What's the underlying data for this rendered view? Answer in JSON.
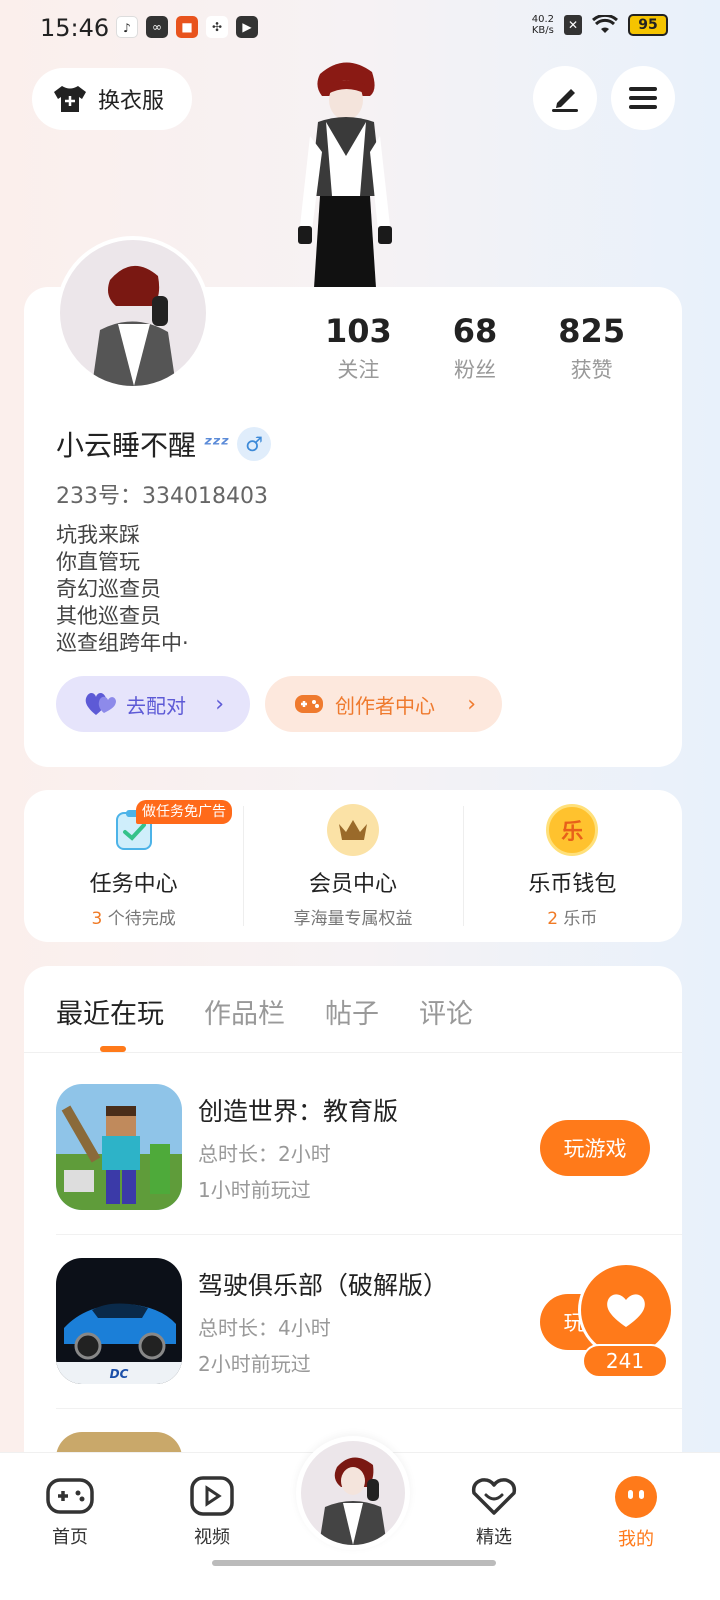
{
  "status_bar": {
    "time": "15:46",
    "speed_value": "40.2",
    "speed_unit": "KB/s",
    "battery": "95",
    "app_icons": [
      "tiktok-icon",
      "link-icon",
      "apps-icon",
      "pinwheel-icon",
      "play-icon"
    ]
  },
  "header": {
    "outfit_label": "换衣服",
    "edit_icon": "pen-icon",
    "menu_icon": "menu-icon"
  },
  "profile": {
    "stats": [
      {
        "value": "103",
        "label": "关注"
      },
      {
        "value": "68",
        "label": "粉丝"
      },
      {
        "value": "825",
        "label": "获赞"
      }
    ],
    "nickname": "小云睡不醒",
    "nickname_emoji": "ᶻᶻᶻ",
    "gender_symbol": "♂",
    "uid": "233号：334018403",
    "bio": [
      "坑我来踩",
      "你直管玩",
      "奇幻巡查员",
      "其他巡查员",
      "巡查组跨年中·"
    ],
    "match_label": "去配对",
    "creator_label": "创作者中心"
  },
  "quick": {
    "task_badge": "做任务免广告",
    "items": [
      {
        "title": "任务中心",
        "count": "3",
        "sub": " 个待完成"
      },
      {
        "title": "会员中心",
        "count": "",
        "sub": "享海量专属权益"
      },
      {
        "title": "乐币钱包",
        "count": "2",
        "sub": " 乐币",
        "coin_glyph": "乐"
      }
    ]
  },
  "recent": {
    "tabs": [
      "最近在玩",
      "作品栏",
      "帖子",
      "评论"
    ],
    "active_tab": 0,
    "play_label": "玩游戏",
    "games": [
      {
        "name": "创造世界：教育版",
        "duration": "总时长：2小时",
        "last": "1小时前玩过"
      },
      {
        "name": "驾驶俱乐部（破解版）",
        "duration": "总时长：4小时",
        "last": "2小时前玩过"
      }
    ]
  },
  "like": {
    "count": "241"
  },
  "nav": {
    "items": [
      {
        "label": "首页"
      },
      {
        "label": "视频"
      },
      {
        "label": "精选"
      },
      {
        "label": "我的"
      }
    ]
  },
  "colors": {
    "accent": "#ff7a1a",
    "match": "#5d5ad6",
    "gender": "#3d8ad8"
  }
}
